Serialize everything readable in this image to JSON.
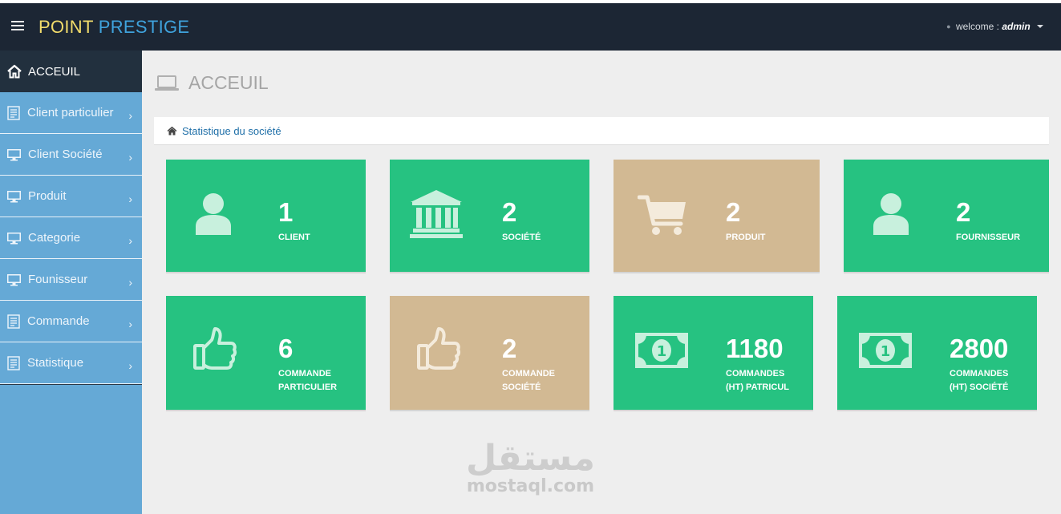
{
  "header": {
    "brand_part1": "POINT",
    "brand_part2": "PRESTIGE",
    "welcome_prefix": "welcome :",
    "user": "admin"
  },
  "sidebar": {
    "active": "ACCEUIL",
    "items": [
      {
        "label": "Client particulier",
        "icon": "document-icon"
      },
      {
        "label": "Client Société",
        "icon": "monitor-icon"
      },
      {
        "label": "Produit",
        "icon": "monitor-icon"
      },
      {
        "label": "Categorie",
        "icon": "monitor-icon"
      },
      {
        "label": "Founisseur",
        "icon": "monitor-icon"
      },
      {
        "label": "Commande",
        "icon": "document-icon"
      },
      {
        "label": "Statistique",
        "icon": "document-icon"
      }
    ],
    "chevron": "›"
  },
  "page": {
    "title": "ACCEUIL",
    "breadcrumb": "Statistique du société"
  },
  "cards": [
    {
      "value": "1",
      "label_1": "CLIENT",
      "label_2": "",
      "color": "#26c281",
      "icon": "user-icon"
    },
    {
      "value": "2",
      "label_1": "SOCIÉTÉ",
      "label_2": "",
      "color": "#26c281",
      "icon": "bank-icon"
    },
    {
      "value": "2",
      "label_1": "PRODUIT",
      "label_2": "",
      "color": "#d2b993",
      "icon": "cart-icon"
    },
    {
      "value": "2",
      "label_1": "FOURNISSEUR",
      "label_2": "",
      "color": "#26c281",
      "icon": "user-icon"
    },
    {
      "value": "6",
      "label_1": "COMMANDE",
      "label_2": "PARTICULIER",
      "color": "#26c281",
      "icon": "thumbs-up-icon"
    },
    {
      "value": "2",
      "label_1": "COMMANDE",
      "label_2": "SOCIÉTÉ",
      "color": "#d2b993",
      "icon": "thumbs-up-icon"
    },
    {
      "value": "1180",
      "label_1": "COMMANDES",
      "label_2": "(HT) PATRICUL",
      "color": "#26c281",
      "icon": "money-icon"
    },
    {
      "value": "2800",
      "label_1": "COMMANDES",
      "label_2": "(HT) SOCIÉTÉ",
      "color": "#26c281",
      "icon": "money-icon"
    }
  ],
  "watermark": {
    "arabic": "مستقل",
    "latin": "mostaql.com"
  }
}
